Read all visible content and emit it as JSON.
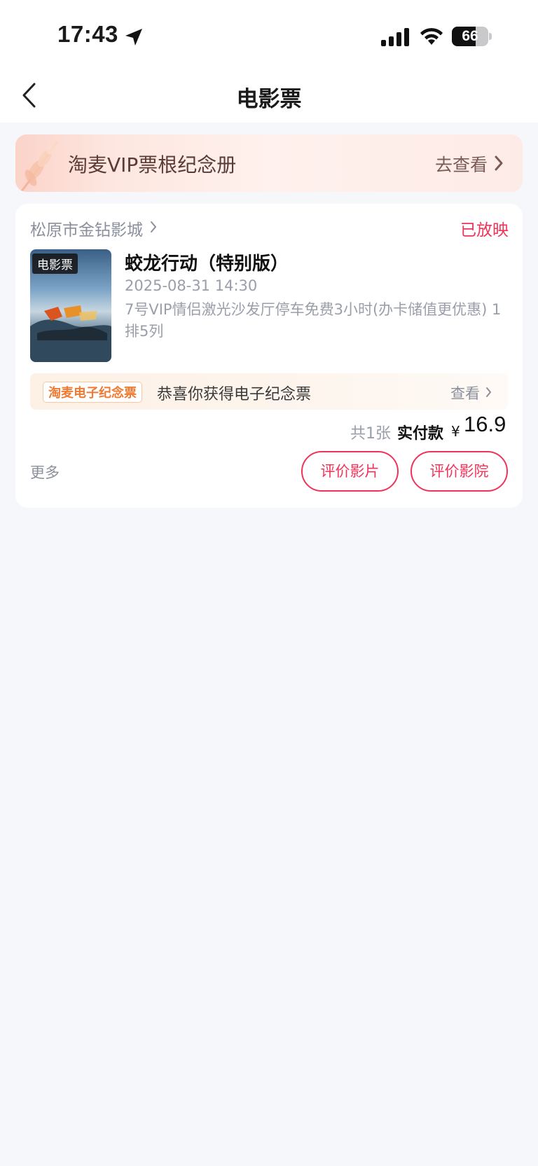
{
  "status_bar": {
    "time": "17:43",
    "battery": "66",
    "battery_level": 0.66
  },
  "nav": {
    "title": "电影票"
  },
  "vip_banner": {
    "title": "淘麦VIP票根纪念册",
    "link": "去查看"
  },
  "order": {
    "cinema": "松原市金钻影城",
    "status": "已放映",
    "poster_badge": "电影票",
    "movie_title": "蛟龙行动（特别版）",
    "show_time": "2025-08-31 14:30",
    "seat_info": "7号VIP情侣激光沙发厅停车免费3小时(办卡储值更优惠) 1排5列",
    "souvenir": {
      "tag": "淘麦电子纪念票",
      "text": "恭喜你获得电子纪念票",
      "link": "查看"
    },
    "ticket_count": "共1张",
    "paid_label": "实付款",
    "currency": "¥",
    "paid_amount": "16.9",
    "more": "更多",
    "buttons": {
      "rate_film": "评价影片",
      "rate_cinema": "评价影院"
    }
  },
  "colors": {
    "accent": "#f0335a",
    "souvenir_orange": "#ef7b33",
    "page_bg": "#f6f7fb"
  }
}
